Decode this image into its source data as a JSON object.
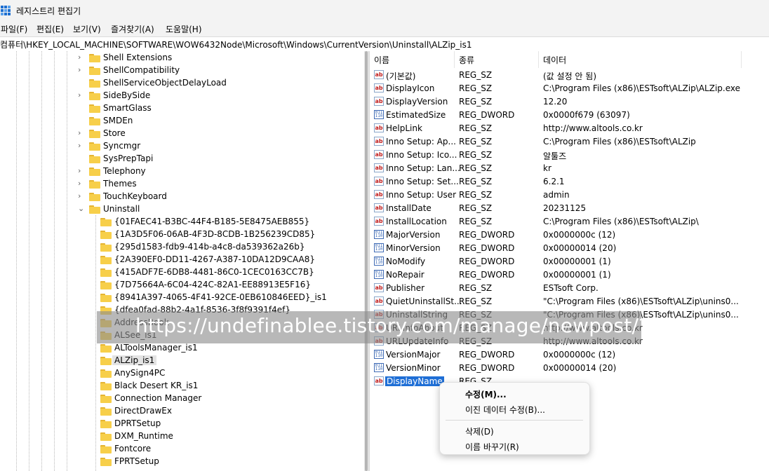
{
  "window": {
    "title": "레지스트리 편집기",
    "icon": "registry-editor-icon"
  },
  "menu": [
    "파일(F)",
    "편집(E)",
    "보기(V)",
    "즐겨찾기(A)",
    "도움말(H)"
  ],
  "address": "컴퓨터\\HKEY_LOCAL_MACHINE\\SOFTWARE\\WOW6432Node\\Microsoft\\Windows\\CurrentVersion\\Uninstall\\ALZip_is1",
  "tree": {
    "level1": [
      {
        "label": "Shell Extensions",
        "expander": "›"
      },
      {
        "label": "ShellCompatibility",
        "expander": "›"
      },
      {
        "label": "ShellServiceObjectDelayLoad",
        "expander": ""
      },
      {
        "label": "SideBySide",
        "expander": "›"
      },
      {
        "label": "SmartGlass",
        "expander": ""
      },
      {
        "label": "SMDEn",
        "expander": ""
      },
      {
        "label": "Store",
        "expander": "›"
      },
      {
        "label": "Syncmgr",
        "expander": "›"
      },
      {
        "label": "SysPrepTapi",
        "expander": ""
      },
      {
        "label": "Telephony",
        "expander": "›"
      },
      {
        "label": "Themes",
        "expander": "›"
      },
      {
        "label": "TouchKeyboard",
        "expander": "›"
      },
      {
        "label": "Uninstall",
        "expander": "⌄"
      }
    ],
    "uninstall_children": [
      "{01FAEC41-B3BC-44F4-B185-5E8475AEB855}",
      "{1A3D5F06-06AB-4F3D-8CDB-1B256239CD85}",
      "{295d1583-fdb9-414b-a4c8-da539362a26b}",
      "{2A390EF0-DD11-4267-A387-10DA12D9CAA8}",
      "{415ADF7E-6DB8-4481-86C0-1CEC0163CC7B}",
      "{7D75664A-6C04-424C-82A1-EE88913E5F16}",
      "{8941A397-4065-4F41-92CE-0EB610846EED}_is1",
      "{dfea0fad-88b2-4a1f-8536-3f8f9391f4ef}",
      "AddressBook",
      "ALSee_is1",
      "ALToolsManager_is1",
      "ALZip_is1",
      "AnySign4PC",
      "Black Desert KR_is1",
      "Connection Manager",
      "DirectDrawEx",
      "DPRTSetup",
      "DXM_Runtime",
      "Fontcore",
      "FPRTSetup"
    ],
    "selected": "ALZip_is1"
  },
  "columns": {
    "name": "이름",
    "type": "종류",
    "data": "데이터"
  },
  "values": [
    {
      "name": "(기본값)",
      "type": "REG_SZ",
      "data": "(값 설정 안 됨)",
      "icon": "string-value-icon"
    },
    {
      "name": "DisplayIcon",
      "type": "REG_SZ",
      "data": "C:\\Program Files (x86)\\ESTsoft\\ALZip\\ALZip.exe",
      "icon": "string-value-icon"
    },
    {
      "name": "DisplayVersion",
      "type": "REG_SZ",
      "data": "12.20",
      "icon": "string-value-icon"
    },
    {
      "name": "EstimatedSize",
      "type": "REG_DWORD",
      "data": "0x0000f679 (63097)",
      "icon": "dword-value-icon"
    },
    {
      "name": "HelpLink",
      "type": "REG_SZ",
      "data": "http://www.altools.co.kr",
      "icon": "string-value-icon"
    },
    {
      "name": "Inno Setup: Ap...",
      "type": "REG_SZ",
      "data": "C:\\Program Files (x86)\\ESTsoft\\ALZip",
      "icon": "string-value-icon"
    },
    {
      "name": "Inno Setup: Ico...",
      "type": "REG_SZ",
      "data": "알툴즈",
      "icon": "string-value-icon"
    },
    {
      "name": "Inno Setup: Lan...",
      "type": "REG_SZ",
      "data": "kr",
      "icon": "string-value-icon"
    },
    {
      "name": "Inno Setup: Set...",
      "type": "REG_SZ",
      "data": "6.2.1",
      "icon": "string-value-icon"
    },
    {
      "name": "Inno Setup: User",
      "type": "REG_SZ",
      "data": "admin",
      "icon": "string-value-icon"
    },
    {
      "name": "InstallDate",
      "type": "REG_SZ",
      "data": "20231125",
      "icon": "string-value-icon"
    },
    {
      "name": "InstallLocation",
      "type": "REG_SZ",
      "data": "C:\\Program Files (x86)\\ESTsoft\\ALZip\\",
      "icon": "string-value-icon"
    },
    {
      "name": "MajorVersion",
      "type": "REG_DWORD",
      "data": "0x0000000c (12)",
      "icon": "dword-value-icon"
    },
    {
      "name": "MinorVersion",
      "type": "REG_DWORD",
      "data": "0x00000014 (20)",
      "icon": "dword-value-icon"
    },
    {
      "name": "NoModify",
      "type": "REG_DWORD",
      "data": "0x00000001 (1)",
      "icon": "dword-value-icon"
    },
    {
      "name": "NoRepair",
      "type": "REG_DWORD",
      "data": "0x00000001 (1)",
      "icon": "dword-value-icon"
    },
    {
      "name": "Publisher",
      "type": "REG_SZ",
      "data": "ESTsoft Corp.",
      "icon": "string-value-icon"
    },
    {
      "name": "QuietUninstallSt...",
      "type": "REG_SZ",
      "data": "\"C:\\Program Files (x86)\\ESTsoft\\ALZip\\unins0...",
      "icon": "string-value-icon"
    },
    {
      "name": "UninstallString",
      "type": "REG_SZ",
      "data": "\"C:\\Program Files (x86)\\ESTsoft\\ALZip\\unins0...",
      "icon": "string-value-icon"
    },
    {
      "name": "URLInfoAbout",
      "type": "REG_SZ",
      "data": "http://www.altools.co.kr",
      "icon": "string-value-icon"
    },
    {
      "name": "URLUpdateInfo",
      "type": "REG_SZ",
      "data": "http://www.altools.co.kr",
      "icon": "string-value-icon"
    },
    {
      "name": "VersionMajor",
      "type": "REG_DWORD",
      "data": "0x0000000c (12)",
      "icon": "dword-value-icon"
    },
    {
      "name": "VersionMinor",
      "type": "REG_DWORD",
      "data": "0x00000014 (20)",
      "icon": "dword-value-icon"
    },
    {
      "name": "DisplayName",
      "type": "REG_SZ",
      "data": "",
      "icon": "string-value-icon"
    }
  ],
  "selected_value": "DisplayName",
  "context_menu": {
    "modify": "수정(M)...",
    "modify_binary": "이진 데이터 수정(B)...",
    "delete": "삭제(D)",
    "rename": "이름 바꾸기(R)"
  },
  "watermark": "https://undefinablee.tistory.com/manage/newpost/?t",
  "colors": {
    "selection": "#1f6fd6",
    "folder": "#f7cf4a",
    "chrome": "#f3f3f3"
  }
}
